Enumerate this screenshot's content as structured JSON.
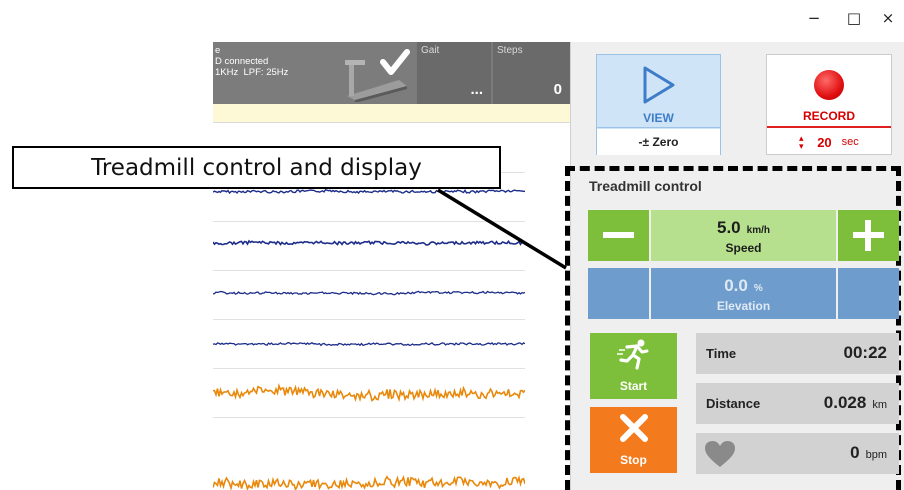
{
  "window": {
    "minimize_glyph": "−",
    "maximize_glyph": "□",
    "close_glyph": "×"
  },
  "status": {
    "line1": "e",
    "line2": "D connected",
    "line3": "1KHz  LPF: 25Hz",
    "gait_label": "Gait",
    "gait_value": "...",
    "steps_label": "Steps",
    "steps_value": "0"
  },
  "annotation": {
    "text": "Treadmill control and display"
  },
  "view_button": {
    "label": "VIEW",
    "zero_label": "-± Zero"
  },
  "record_button": {
    "label": "RECORD",
    "arrows": "▴▾",
    "seconds": "20",
    "unit": "sec"
  },
  "treadmill": {
    "title": "Treadmill control",
    "speed": {
      "value": "5.0",
      "unit": "km/h",
      "label": "Speed"
    },
    "elevation": {
      "value": "0.0",
      "unit": "%",
      "label": "Elevation"
    },
    "start_label": "Start",
    "stop_label": "Stop",
    "time": {
      "label": "Time",
      "value": "00:22"
    },
    "distance": {
      "label": "Distance",
      "value": "0.028",
      "unit": "km"
    },
    "heart_rate": {
      "value": "0",
      "unit": "bpm"
    }
  },
  "colors": {
    "trace_blue": "#1d2d8a",
    "trace_orange": "#e8890c",
    "speed_green": "#7dbf3a",
    "elevation_blue": "#6e9dcd",
    "stop_orange": "#f37b1d",
    "record_red": "#d60000"
  }
}
